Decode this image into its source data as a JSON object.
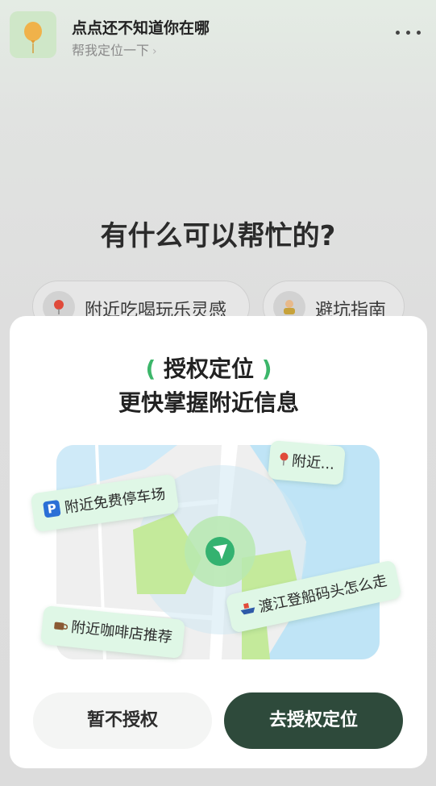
{
  "header": {
    "title": "点点还不知道你在哪",
    "subtitle": "帮我定位一下",
    "chevron": "›"
  },
  "main": {
    "question": "有什么可以帮忙的?",
    "chips": [
      {
        "icon": "map-pin-icon",
        "label": "附近吃喝玩乐灵感"
      },
      {
        "icon": "person-warning-icon",
        "label": "避坑指南"
      }
    ]
  },
  "dialog": {
    "title_open": "(",
    "title": "授权定位",
    "title_close": ")",
    "subtitle": "更快掌握附近信息",
    "map_tags": [
      {
        "icon": "parking-icon",
        "icon_text": "P",
        "label": "附近免费停车场"
      },
      {
        "icon": "map-pin-icon",
        "label": "附近..."
      },
      {
        "icon": "coffee-icon",
        "label": "附近咖啡店推荐"
      },
      {
        "icon": "ship-icon",
        "label": "渡江登船码头怎么走"
      }
    ],
    "decline_label": "暂不授权",
    "accept_label": "去授权定位"
  },
  "colors": {
    "accent_green": "#3cb66a",
    "primary_button": "#2e4a3b",
    "tag_bg": "#dff7e6"
  }
}
